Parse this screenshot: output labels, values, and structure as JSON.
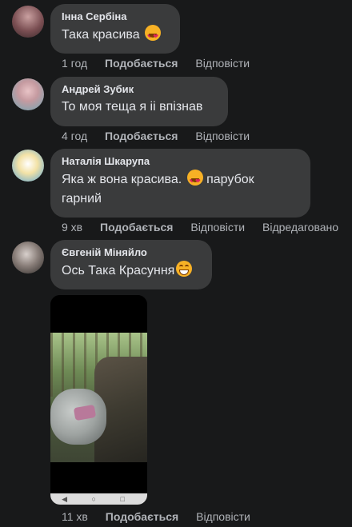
{
  "comments": [
    {
      "author": "Інна Сербіна",
      "text": "Така красива",
      "emoji": "heart-eyes",
      "time": "1 год",
      "like": "Подобається",
      "reply": "Відповісти"
    },
    {
      "author": "Андрей Зубик",
      "text": "То моя теща я іі впізнав",
      "time": "4 год",
      "like": "Подобається",
      "reply": "Відповісти"
    },
    {
      "author": "Наталія Шкарупа",
      "text_part1": "Яка ж вона красива.",
      "emoji": "heart-eyes",
      "text_part2": "парубок",
      "text_line2": "гарний",
      "time": "9 хв",
      "like": "Подобається",
      "reply": "Відповісти",
      "edited": "Відредаговано"
    },
    {
      "author": "Євгеній Міняйло",
      "text": "Ось Така Красуння",
      "emoji": "grin",
      "time": "11 хв",
      "like": "Подобається",
      "reply": "Відповісти"
    }
  ],
  "colors": {
    "background": "#18191a",
    "bubble": "#3a3b3c",
    "meta_text": "#b0b3b8",
    "text": "#e4e6eb"
  },
  "attachment": {
    "navbar_glyphs": "◀ ○ □"
  }
}
